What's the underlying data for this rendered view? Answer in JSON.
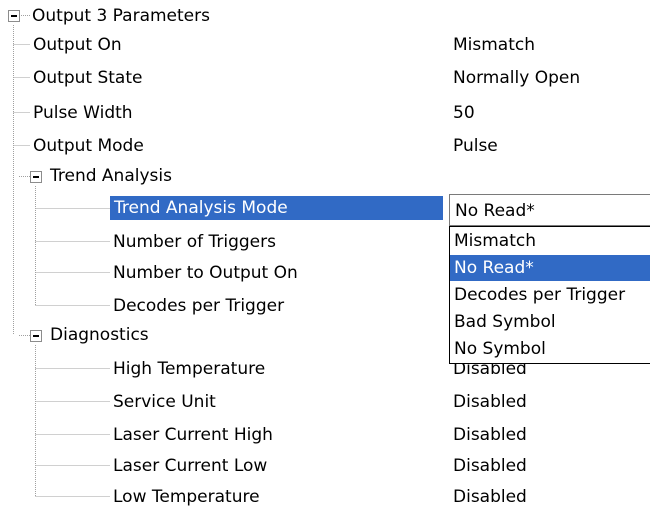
{
  "tree": {
    "root": {
      "label": "Output 3 Parameters"
    },
    "items": [
      {
        "label": "Output On",
        "value": "Mismatch"
      },
      {
        "label": "Output State",
        "value": "Normally Open"
      },
      {
        "label": "Pulse Width",
        "value": "50"
      },
      {
        "label": "Output Mode",
        "value": "Pulse"
      }
    ],
    "trend": {
      "label": "Trend Analysis",
      "mode_label": "Trend Analysis Mode",
      "items": [
        {
          "label": "Number of Triggers"
        },
        {
          "label": "Number to Output On"
        },
        {
          "label": "Decodes per Trigger"
        }
      ]
    },
    "diagnostics": {
      "label": "Diagnostics",
      "items": [
        {
          "label": "High Temperature",
          "value": "Disabled"
        },
        {
          "label": "Service Unit",
          "value": "Disabled"
        },
        {
          "label": "Laser Current High",
          "value": "Disabled"
        },
        {
          "label": "Laser Current Low",
          "value": "Disabled"
        },
        {
          "label": "Low Temperature",
          "value": "Disabled"
        }
      ]
    }
  },
  "combo": {
    "value": "No Read*",
    "options": [
      "Mismatch",
      "No Read*",
      "Decodes per Trigger",
      "Bad Symbol",
      "No Symbol"
    ],
    "selected_index": 1
  },
  "colors": {
    "selection": "#316ac5",
    "tree_line": "#a0a0a0"
  }
}
